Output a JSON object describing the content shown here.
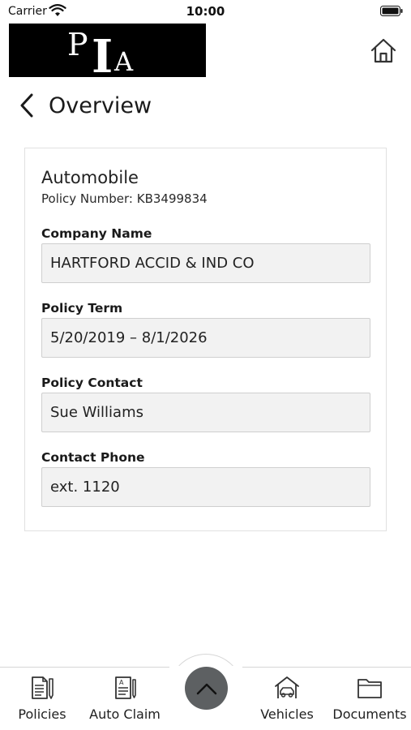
{
  "status_bar": {
    "carrier": "Carrier",
    "time": "10:00"
  },
  "header": {
    "logo_letters": {
      "p": "P",
      "i": "I",
      "a": "A"
    },
    "home_icon": "home-icon"
  },
  "navigation": {
    "back_icon": "chevron-left-icon",
    "title": "Overview"
  },
  "policy": {
    "type": "Automobile",
    "number_line": "Policy Number: KB3499834",
    "fields": [
      {
        "label": "Company Name",
        "value": "HARTFORD ACCID & IND CO"
      },
      {
        "label": "Policy Term",
        "value": "5/20/2019 – 8/1/2026"
      },
      {
        "label": "Policy Contact",
        "value": "Sue Williams"
      },
      {
        "label": "Contact Phone",
        "value": "ext. 1120"
      }
    ]
  },
  "bottom_nav": {
    "items": [
      {
        "label": "Policies",
        "icon": "policies-document-icon"
      },
      {
        "label": "Auto Claim",
        "icon": "auto-claim-form-icon"
      },
      {
        "label": "Vehicles",
        "icon": "vehicle-garage-icon"
      },
      {
        "label": "Documents",
        "icon": "folder-icon"
      }
    ],
    "center_icon": "chevron-up-icon"
  },
  "colors": {
    "logo_background": "#000000",
    "field_background": "#f2f2f2",
    "center_button": "#5d6062"
  }
}
